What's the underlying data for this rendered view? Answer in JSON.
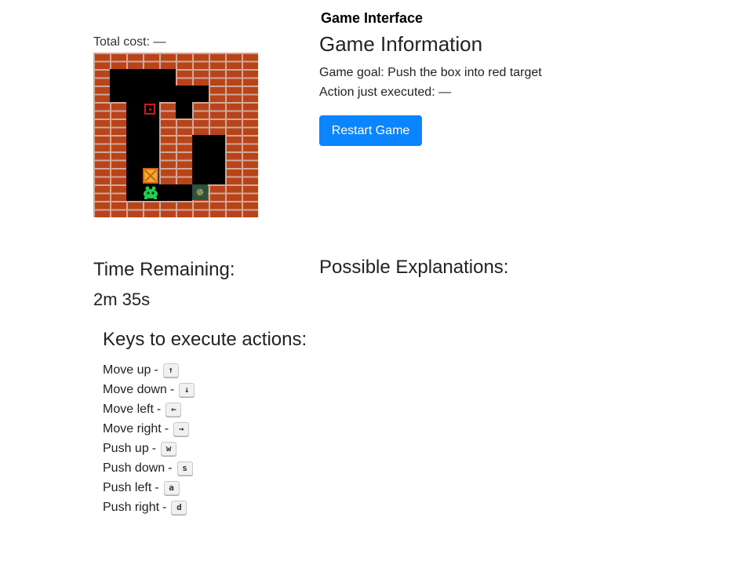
{
  "header": {
    "title": "Game Interface"
  },
  "board_panel": {
    "total_cost_label": "Total cost:",
    "total_cost_value": "—"
  },
  "info": {
    "title": "Game Information",
    "goal_label": "Game goal:",
    "goal_value": "Push the box into red target",
    "action_label": "Action just executed:",
    "action_value": "—",
    "restart_label": "Restart Game"
  },
  "timer": {
    "label": "Time Remaining:",
    "value": "2m 35s"
  },
  "explanations": {
    "title": "Possible Explanations:"
  },
  "keys": {
    "title": "Keys to execute actions:",
    "items": [
      {
        "label": "Move up",
        "key": "↑"
      },
      {
        "label": "Move down",
        "key": "↓"
      },
      {
        "label": "Move left",
        "key": "←"
      },
      {
        "label": "Move right",
        "key": "→"
      },
      {
        "label": "Push up",
        "key": "w"
      },
      {
        "label": "Push down",
        "key": "s"
      },
      {
        "label": "Push left",
        "key": "a"
      },
      {
        "label": "Push right",
        "key": "d"
      }
    ]
  },
  "colors": {
    "brick": "#b9441a",
    "floor": "#000000",
    "target": "#d6151a",
    "box": "#f2ad2a",
    "player": "#1fd04a",
    "button": "#0a84ff"
  },
  "icons": {
    "wall": "brick-wall-tile",
    "target": "red-target-square",
    "box": "crate-icon",
    "player": "green-alien-player-icon",
    "other": "unknown-dark-tile-icon"
  }
}
